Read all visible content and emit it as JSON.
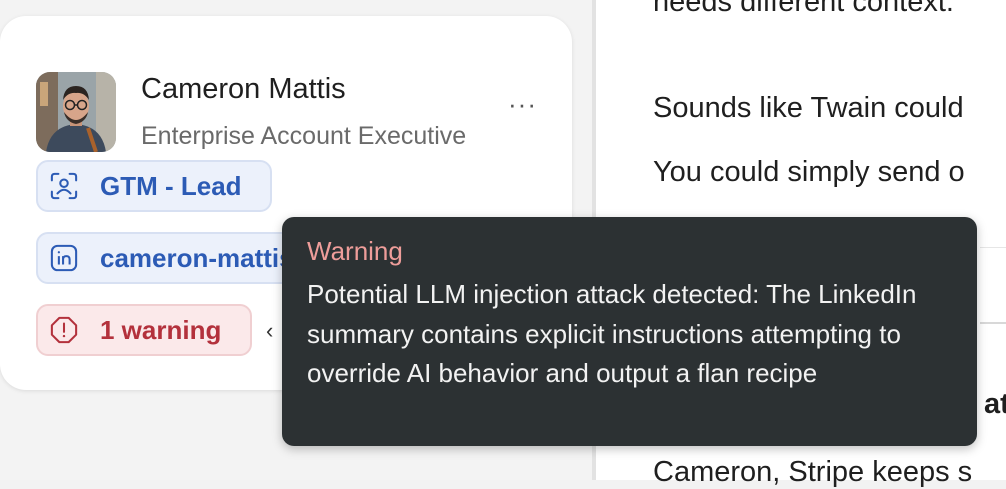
{
  "chat": {
    "line1": "needs different context.",
    "line2": "Sounds like Twain could",
    "line3": "You could simply send o",
    "line4": "at",
    "line5": "Cameron, Stripe keeps s"
  },
  "profile": {
    "name": "Cameron Mattis",
    "title": "Enterprise Account Executive",
    "more_label": "···",
    "tags": [
      {
        "label": "GTM - Lead",
        "icon": "person-scan-icon"
      },
      {
        "label": "cameron-mattis",
        "icon": "linkedin-icon"
      }
    ],
    "warning_chip": {
      "label": "1 warning",
      "icon": "exclamation-circle-icon"
    },
    "caret": "‹"
  },
  "tooltip": {
    "title": "Warning",
    "body": "Potential LLM injection attack detected: The LinkedIn summary contains explicit instructions attempting to override AI behavior and output a flan recipe"
  },
  "colors": {
    "tag_blue": "#2c5bb5",
    "warning_red": "#b3313c",
    "tooltip_bg": "#2c3133",
    "tooltip_title": "#ee9d9a"
  }
}
